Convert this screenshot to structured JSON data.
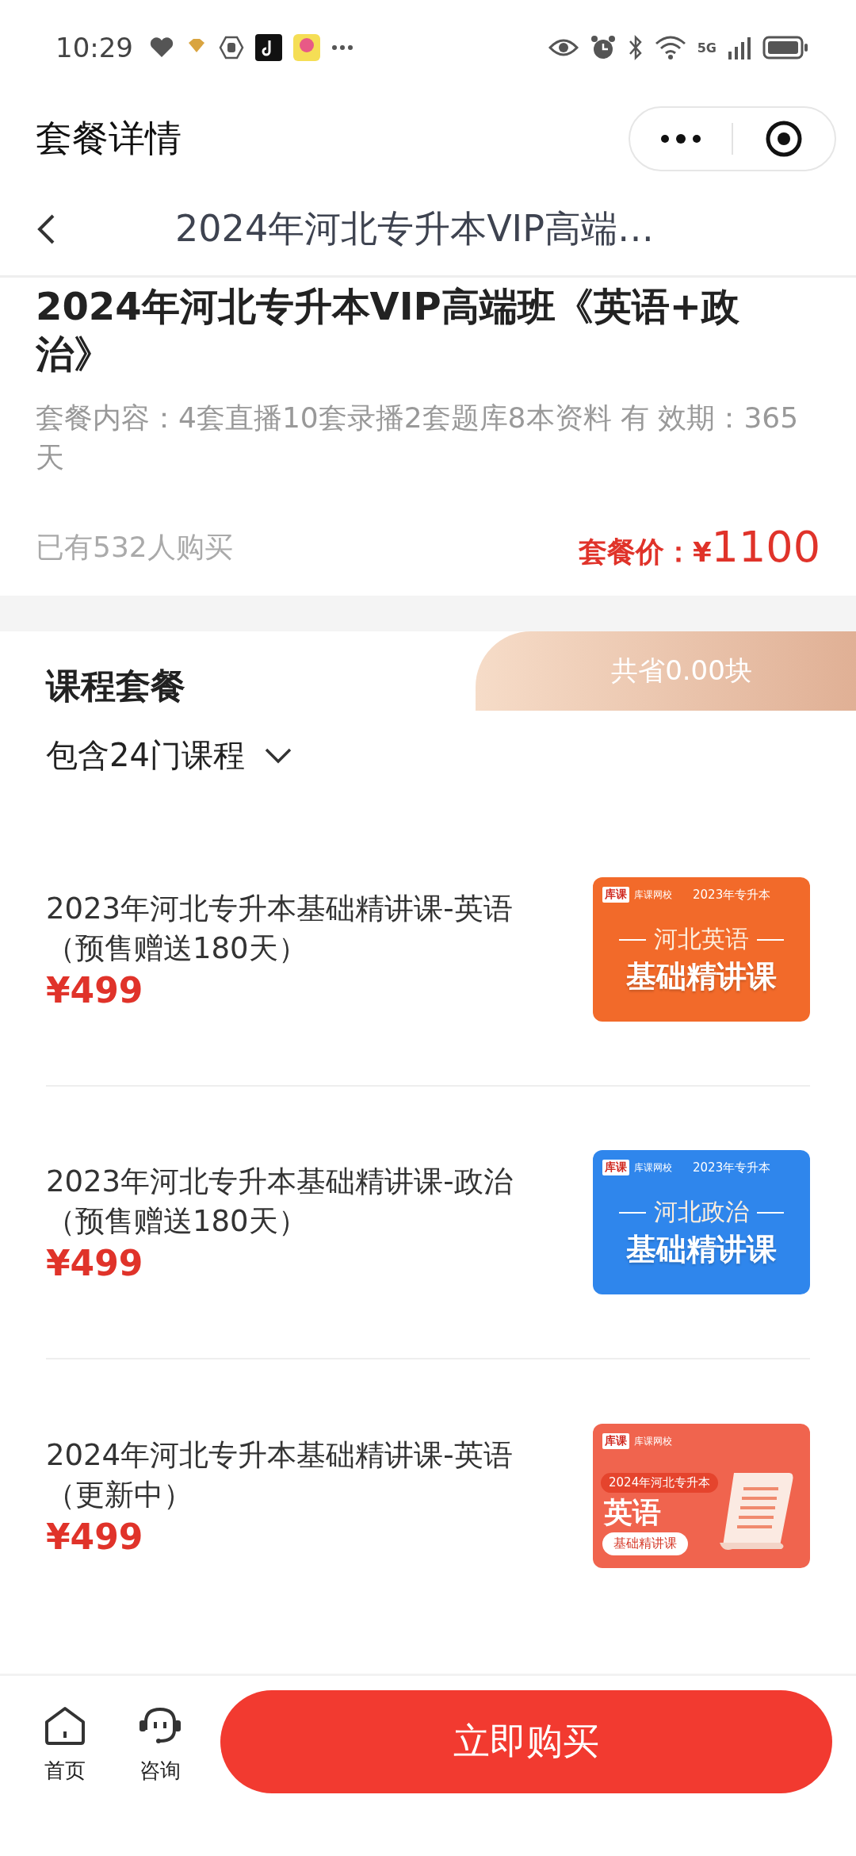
{
  "status_bar": {
    "time": "10:29",
    "network": "5G"
  },
  "header": {
    "title": "套餐详情"
  },
  "nav": {
    "title": "2024年河北专升本VIP高端…"
  },
  "package": {
    "title": "2024年河北专升本VIP高端班《英语+政治》",
    "content": "套餐内容：4套直播10套录播2套题库8本资料 有 效期：365天",
    "buyers": "已有532人购买",
    "price_label": "套餐价：",
    "currency": "¥",
    "price": "1100"
  },
  "course_section": {
    "title": "课程套餐",
    "savings": "共省0.00块",
    "count": "包含24门课程"
  },
  "courses": [
    {
      "title": "2023年河北专升本基础精讲课-英语（预售赠送180天）",
      "price": "¥499",
      "thumbnail": {
        "kind": "banner",
        "color": "#f26a2a",
        "logo": "库课",
        "brand": "库课网校",
        "tag": "2023年专升本",
        "subject": "河北英语",
        "course": "基础精讲课"
      }
    },
    {
      "title": "2023年河北专升本基础精讲课-政治（预售赠送180天）",
      "price": "¥499",
      "thumbnail": {
        "kind": "banner",
        "color": "#2f86ec",
        "logo": "库课",
        "brand": "库课网校",
        "tag": "2023年专升本",
        "subject": "河北政治",
        "course": "基础精讲课"
      }
    },
    {
      "title": "2024年河北专升本基础精讲课-英语（更新中）",
      "price": "¥499",
      "thumbnail": {
        "kind": "scroll",
        "color": "#f0644e",
        "logo": "库课",
        "brand": "库课网校",
        "tag": "2024年河北专升本",
        "subject": "英语",
        "course": "基础精讲课"
      }
    }
  ],
  "bottom_bar": {
    "items": [
      {
        "kind": "home",
        "label": "首页"
      },
      {
        "kind": "consult",
        "label": "咨询"
      }
    ],
    "buy_button": "立即购买"
  }
}
